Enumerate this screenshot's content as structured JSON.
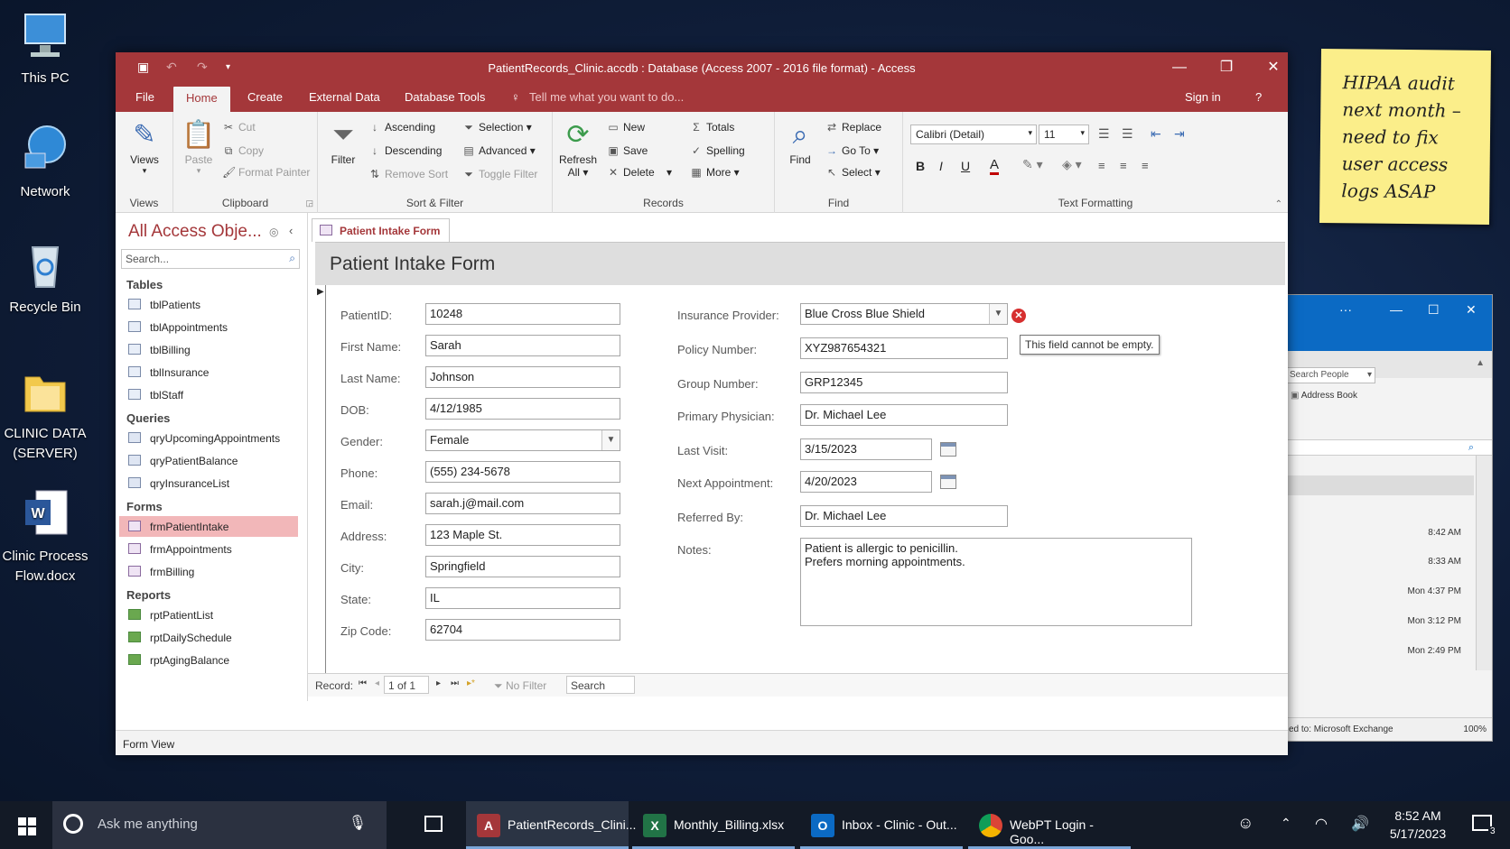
{
  "desktop": {
    "icons": [
      {
        "label": "This PC",
        "icon": "computer-icon"
      },
      {
        "label": "Network",
        "icon": "network-icon"
      },
      {
        "label": "Recycle Bin",
        "icon": "recycle-bin-icon"
      },
      {
        "label_line1": "CLINIC DATA",
        "label_line2": "(SERVER)",
        "icon": "folder-icon"
      },
      {
        "label_line1": "Clinic Process",
        "label_line2": "Flow.docx",
        "icon": "word-document-icon"
      }
    ],
    "sticky_note": {
      "line1": "HIPAA audit",
      "line2": "next month –",
      "line3": "need to fix",
      "line4": "user access",
      "line5": "logs ASAP"
    }
  },
  "outlook_window": {
    "ellipsis": "···",
    "search_people": "Search People",
    "address_book": "Address Book",
    "times": [
      "8:42 AM",
      "8:33 AM",
      "Mon 4:37 PM",
      "Mon 3:12 PM",
      "Mon 2:49 PM"
    ],
    "status": "ed to: Microsoft Exchange",
    "zoom": "100%"
  },
  "access": {
    "title": "PatientRecords_Clinic.accdb : Database (Access 2007 - 2016 file format)  -  Access",
    "menu": {
      "file": "File",
      "home": "Home",
      "create": "Create",
      "external": "External Data",
      "dbtools": "Database Tools",
      "tellme": "Tell me what you want to do...",
      "signin": "Sign in",
      "help": "?"
    },
    "ribbon": {
      "views": {
        "button": "Views",
        "group": "Views"
      },
      "clipboard": {
        "paste": "Paste",
        "cut": "Cut",
        "copy": "Copy",
        "format_painter": "Format Painter",
        "group": "Clipboard"
      },
      "sort_filter": {
        "filter": "Filter",
        "ascending": "Ascending",
        "descending": "Descending",
        "remove_sort": "Remove Sort",
        "selection": "Selection",
        "advanced": "Advanced",
        "toggle_filter": "Toggle Filter",
        "group": "Sort & Filter"
      },
      "records": {
        "refresh": "Refresh",
        "refresh2": "All",
        "new": "New",
        "save": "Save",
        "delete": "Delete",
        "totals": "Totals",
        "spelling": "Spelling",
        "more": "More",
        "group": "Records"
      },
      "find": {
        "find": "Find",
        "replace": "Replace",
        "goto": "Go To",
        "select": "Select",
        "group": "Find"
      },
      "text_formatting": {
        "font": "Calibri (Detail)",
        "size": "11",
        "bold": "B",
        "italic": "I",
        "underline": "U",
        "font_color": "A",
        "group": "Text Formatting"
      }
    },
    "nav_pane": {
      "title": "All Access Obje...",
      "search_placeholder": "Search...",
      "tables_header": "Tables",
      "tables": [
        "tblPatients",
        "tblAppointments",
        "tblBilling",
        "tblInsurance",
        "tblStaff"
      ],
      "queries_header": "Queries",
      "queries": [
        "qryUpcomingAppointments",
        "qryPatientBalance",
        "qryInsuranceList"
      ],
      "forms_header": "Forms",
      "forms": [
        "frmPatientIntake",
        "frmAppointments",
        "frmBilling"
      ],
      "reports_header": "Reports",
      "reports": [
        "rptPatientList",
        "rptDailySchedule",
        "rptAgingBalance"
      ]
    },
    "doc_tab": "Patient Intake Form",
    "form": {
      "heading": "Patient Intake Form",
      "left": [
        {
          "label": "PatientID:",
          "value": "10248"
        },
        {
          "label": "First Name:",
          "value": "Sarah"
        },
        {
          "label": "Last Name:",
          "value": "Johnson"
        },
        {
          "label": "DOB:",
          "value": "4/12/1985"
        },
        {
          "label": "Gender:",
          "value": "Female"
        },
        {
          "label": "Phone:",
          "value": "(555) 234-5678"
        },
        {
          "label": "Email:",
          "value": "sarah.j@mail.com"
        },
        {
          "label": "Address:",
          "value": "123 Maple St."
        },
        {
          "label": "City:",
          "value": "Springfield"
        },
        {
          "label": "State:",
          "value": "IL"
        },
        {
          "label": "Zip Code:",
          "value": "62704"
        }
      ],
      "right": [
        {
          "label": "Insurance Provider:",
          "value": "Blue Cross Blue Shield"
        },
        {
          "label": "Policy Number:",
          "value": "XYZ987654321"
        },
        {
          "label": "Group Number:",
          "value": "GRP12345"
        },
        {
          "label": "Primary Physician:",
          "value": "Dr. Michael Lee"
        },
        {
          "label": "Last Visit:",
          "value": "3/15/2023"
        },
        {
          "label": "Next Appointment:",
          "value": "4/20/2023"
        },
        {
          "label": "Referred By:",
          "value": "Dr. Michael Lee"
        }
      ],
      "notes_label": "Notes:",
      "notes_line1": "Patient is allergic to penicillin.",
      "notes_line2": "Prefers morning appointments.",
      "validation_tooltip": "This field cannot be empty."
    },
    "record_nav": {
      "label": "Record:",
      "position": "1 of 1",
      "no_filter": "No Filter",
      "search": "Search"
    },
    "status_bar": "Form View"
  },
  "taskbar": {
    "search": "Ask me anything",
    "apps": [
      {
        "label": "PatientRecords_Clini...",
        "icon": "access-icon",
        "color": "#a4373a"
      },
      {
        "label": "Monthly_Billing.xlsx",
        "icon": "excel-icon",
        "color": "#217346"
      },
      {
        "label": "Inbox - Clinic - Out...",
        "icon": "outlook-icon",
        "color": "#0b6ac4"
      },
      {
        "label": "WebPT Login - Goo...",
        "icon": "chrome-icon",
        "color": "#4caf50"
      }
    ],
    "time": "8:52 AM",
    "date": "5/17/2023",
    "notifications": "3"
  }
}
